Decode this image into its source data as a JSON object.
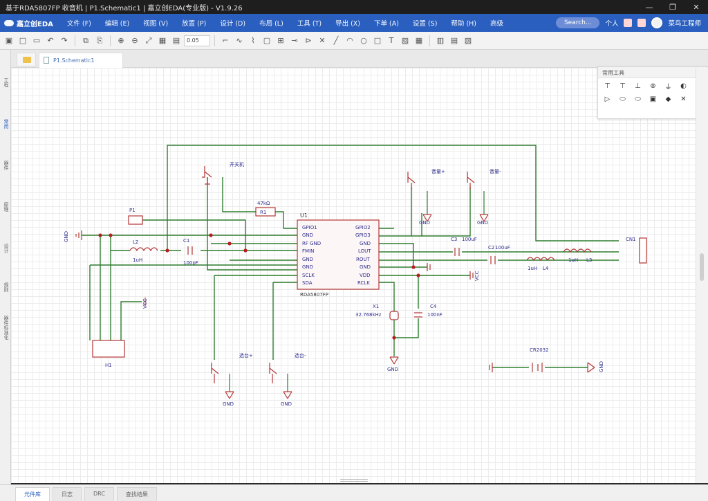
{
  "window": {
    "title": "基于RDA5807FP 收音机 | P1.Schematic1 | 嘉立创EDA(专业版) - V1.9.26",
    "min": "—",
    "max": "❐",
    "close": "✕"
  },
  "menubar": {
    "logo": "嘉立创EDA",
    "items": [
      "文件 (F)",
      "编辑 (E)",
      "视图 (V)",
      "放置 (P)",
      "设计 (D)",
      "布局 (L)",
      "工具 (T)",
      "导出 (X)",
      "下单 (A)",
      "设置 (S)",
      "帮助 (H)",
      "高级"
    ],
    "search": "Search...",
    "user_mode": "个人",
    "username": "菜鸟工程师"
  },
  "toolbar": {
    "zoom": "0.05",
    "icons": [
      "save-icon",
      "new-icon",
      "open-icon",
      "undo-icon",
      "redo-icon",
      "copy-icon",
      "paste-icon",
      "zoom-in-icon",
      "zoom-out-icon",
      "fit-icon",
      "grid-icon",
      "snap-icon",
      "wire-icon",
      "bus-icon",
      "netlabel-icon",
      "netport-icon",
      "noconnect-icon",
      "line-icon",
      "arc-icon",
      "circle-icon",
      "rect-icon",
      "text-icon",
      "image-icon",
      "table-icon",
      "lib-icon",
      "drc-icon"
    ]
  },
  "left_panel": {
    "tabs": [
      "工程",
      "常用",
      "器件",
      "原理",
      "设计",
      "规则",
      "器件标准化"
    ]
  },
  "doc_tabs": [
    {
      "label": "P1.Schematic1"
    }
  ],
  "palette": {
    "title": "常用工具",
    "tools": [
      "net-flag-icon",
      "net-flag-2-icon",
      "power-icon",
      "netport-icon",
      "ground-icon",
      "pin-icon",
      "bus-entry-icon",
      "oval-icon",
      "box-icon",
      "probe-icon",
      "no-connect-icon"
    ]
  },
  "schematic": {
    "u1": {
      "ref": "U1",
      "part": "RDA5807FP",
      "left_pins": [
        "GPIO1",
        "GND",
        "RF GND",
        "FMIN",
        "GND",
        "GND",
        "SCLK",
        "SDA"
      ],
      "right_pins": [
        "GPIO2",
        "GPIO3",
        "GND",
        "LOUT",
        "ROUT",
        "GND",
        "VDD",
        "RCLK"
      ]
    },
    "labels": {
      "gnd_left": "GND",
      "p1": "P1",
      "l2": "L2",
      "l2_val": "1uH",
      "c1": "C1",
      "c1_val": "100pF",
      "sw_power": "开关机",
      "r1": "47kΩ",
      "r1_ref": "R1",
      "vol_up": "音量+",
      "vol_down": "音量-",
      "c3": "C3",
      "c3_val": "100uF",
      "c2": "C2",
      "c2_val": "100uF",
      "l4_val": "1uH",
      "l4": "L4",
      "l3_val": "1uH",
      "l3": "L3",
      "cn1": "CN1",
      "vcc": "VCC",
      "x1": "X1",
      "x1_val": "32.768kHz",
      "c4": "C4",
      "c4_val": "100nF",
      "seek_up": "选台+",
      "seek_down": "选台-",
      "h1": "H1",
      "cr2032": "CR2032",
      "gnd": "GND"
    }
  },
  "bottom_tabs": [
    "元件库",
    "日志",
    "DRC",
    "查找结果"
  ]
}
